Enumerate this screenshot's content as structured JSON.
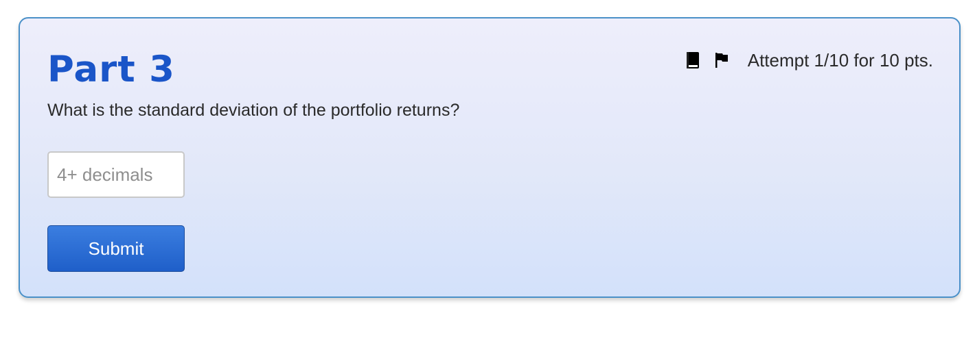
{
  "part": {
    "title": "Part 3",
    "question": "What is the standard deviation of the portfolio returns?"
  },
  "answer": {
    "placeholder": "4+ decimals",
    "value": ""
  },
  "submit": {
    "label": "Submit"
  },
  "header": {
    "attempt_text": "Attempt 1/10 for 10 pts.",
    "icons": [
      "book-icon",
      "flag-icon"
    ]
  },
  "colors": {
    "title": "#1a55c8",
    "card_border": "#4a90c8",
    "button": "#1f5fc9"
  }
}
